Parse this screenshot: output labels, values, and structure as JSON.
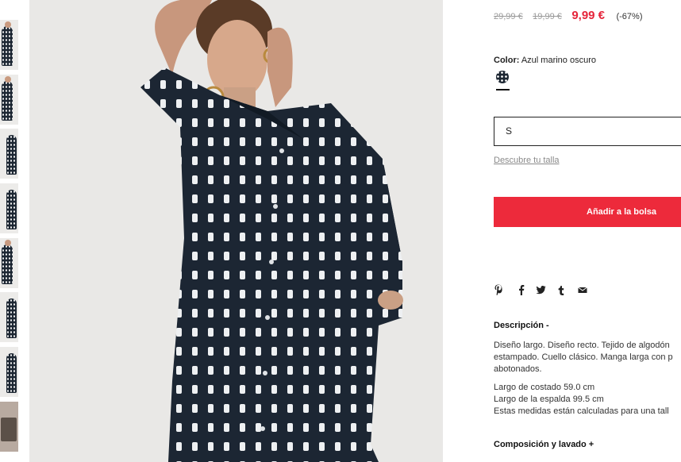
{
  "product": {
    "original_price": "29,99 €",
    "previous_price": "19,99 €",
    "sale_price": "9,99 €",
    "discount": "(-67%)",
    "color_label": "Color:",
    "color_value": "Azul marino oscuro",
    "swatch_color": "#1d2733",
    "selected_size": "S",
    "size_guide_link": "Descubre tu talla",
    "add_to_bag": "Añadir a la bolsa",
    "accent_color": "#ed2a3b"
  },
  "share": {
    "icons": [
      "pinterest-icon",
      "facebook-icon",
      "twitter-icon",
      "tumblr-icon",
      "email-icon"
    ]
  },
  "description": {
    "title": "Descripción -",
    "line1": "Diseño largo. Diseño recto. Tejido de algodón",
    "line2": "estampado. Cuello clásico. Manga larga con p",
    "line3": "abotonados.",
    "measure1": "Largo de costado 59.0 cm",
    "measure2": "Largo de la espalda 99.5 cm",
    "measure3": "Estas medidas están calculadas para una tall"
  },
  "composition_title": "Composición y lavado +",
  "gallery": {
    "thumbnail_count": 8
  }
}
